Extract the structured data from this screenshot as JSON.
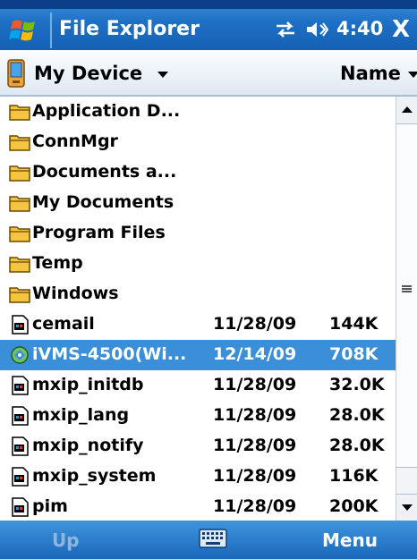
{
  "titlebar": {
    "title": "File Explorer",
    "clock": "4:40",
    "start_icon": "windows-flag-icon",
    "connectivity_icon": "connectivity-arrows-icon",
    "volume_icon": "speaker-volume-icon",
    "close_label": "X"
  },
  "location": {
    "label": "My Device",
    "device_icon": "pda-device-icon",
    "sort_label": "Name"
  },
  "files": [
    {
      "name": "Application D...",
      "date": "",
      "size": "",
      "icon": "folder-icon",
      "selected": false
    },
    {
      "name": "ConnMgr",
      "date": "",
      "size": "",
      "icon": "folder-icon",
      "selected": false
    },
    {
      "name": "Documents a...",
      "date": "",
      "size": "",
      "icon": "folder-icon",
      "selected": false
    },
    {
      "name": "My Documents",
      "date": "",
      "size": "",
      "icon": "folder-icon",
      "selected": false
    },
    {
      "name": "Program Files",
      "date": "",
      "size": "",
      "icon": "folder-icon",
      "selected": false
    },
    {
      "name": "Temp",
      "date": "",
      "size": "",
      "icon": "folder-icon",
      "selected": false
    },
    {
      "name": "Windows",
      "date": "",
      "size": "",
      "icon": "folder-icon",
      "selected": false
    },
    {
      "name": "cemail",
      "date": "11/28/09",
      "size": "144K",
      "icon": "program-file-icon",
      "selected": false
    },
    {
      "name": "iVMS-4500(Wi...",
      "date": "12/14/09",
      "size": "708K",
      "icon": "install-cab-icon",
      "selected": true
    },
    {
      "name": "mxip_initdb",
      "date": "11/28/09",
      "size": "32.0K",
      "icon": "program-file-icon",
      "selected": false
    },
    {
      "name": "mxip_lang",
      "date": "11/28/09",
      "size": "28.0K",
      "icon": "program-file-icon",
      "selected": false
    },
    {
      "name": "mxip_notify",
      "date": "11/28/09",
      "size": "28.0K",
      "icon": "program-file-icon",
      "selected": false
    },
    {
      "name": "mxip_system",
      "date": "11/28/09",
      "size": "116K",
      "icon": "program-file-icon",
      "selected": false
    },
    {
      "name": "pim",
      "date": "11/28/09",
      "size": "200K",
      "icon": "program-file-icon",
      "selected": false
    }
  ],
  "softkeys": {
    "left": "Up",
    "right": "Menu",
    "keyboard_icon": "keyboard-icon"
  },
  "colors": {
    "titlebar": "#1d6fc4",
    "selection": "#3a8fd8",
    "folder": "#f5c542"
  }
}
